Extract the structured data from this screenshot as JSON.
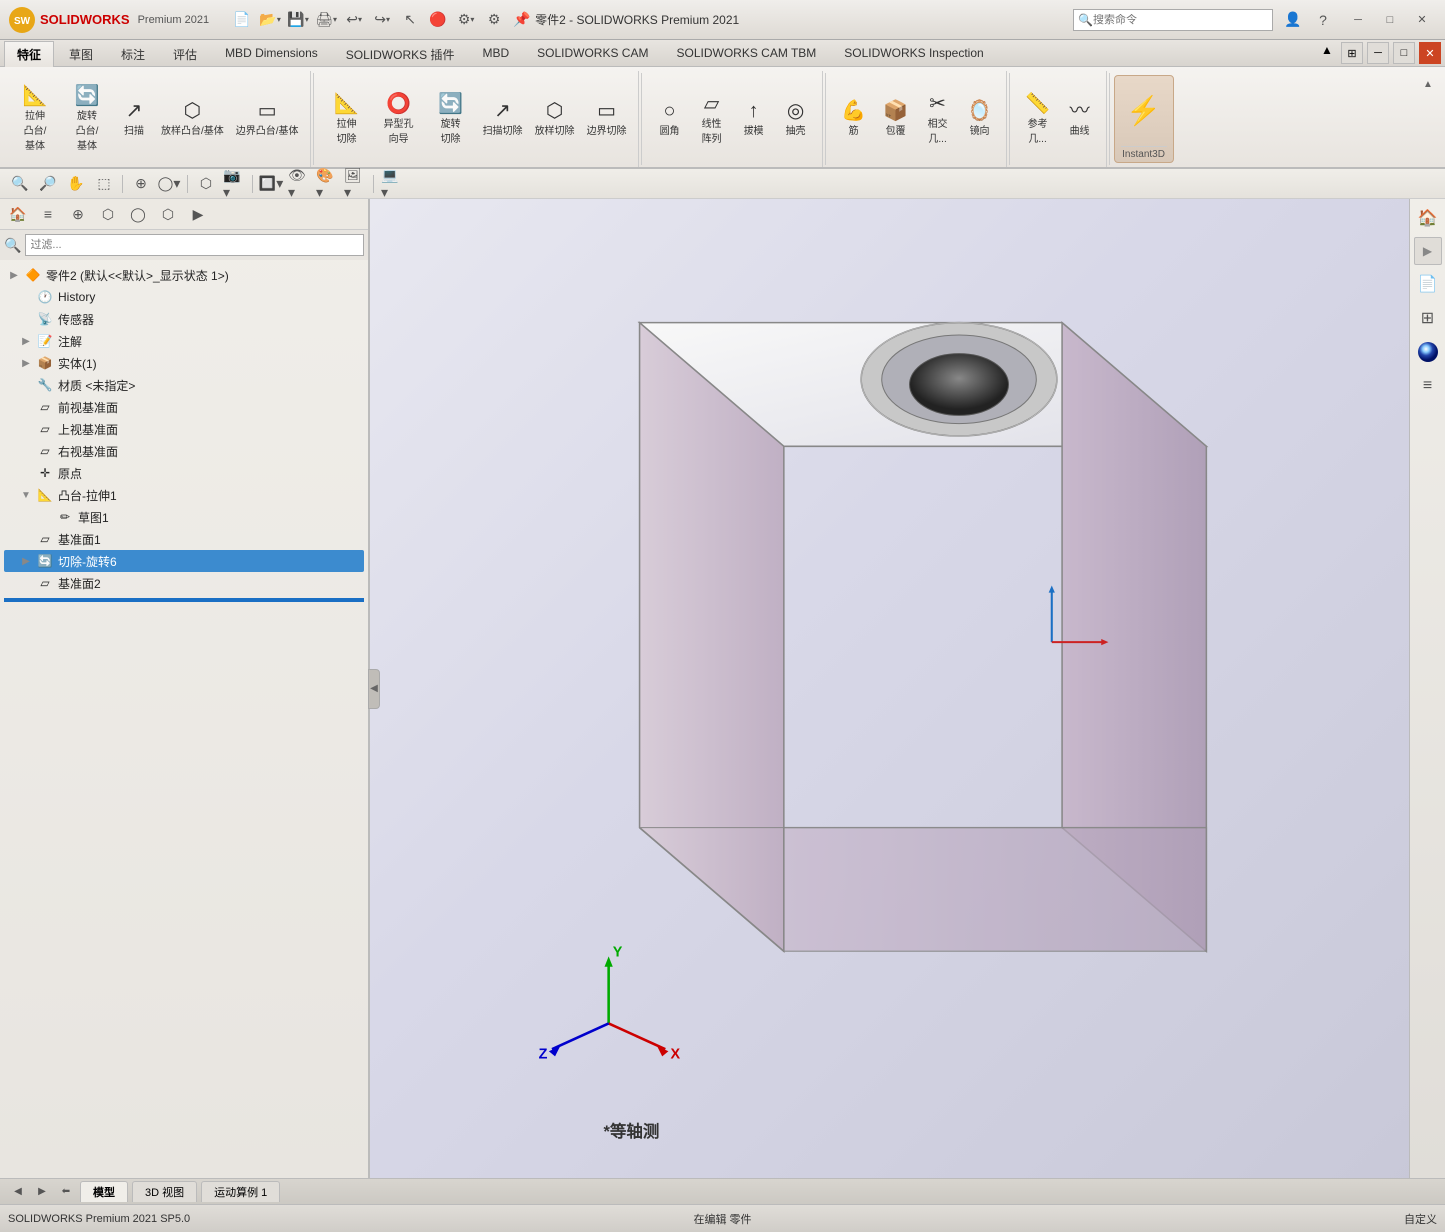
{
  "app": {
    "title": "零件2 - SOLIDWORKS Premium 2021",
    "logo_text": "SOLIDWORKS"
  },
  "titlebar": {
    "search_placeholder": "搜索命令",
    "help_icon": "?",
    "minimize": "─",
    "maximize": "□",
    "close": "✕"
  },
  "ribbon": {
    "tabs": [
      "特征",
      "草图",
      "标注",
      "评估",
      "MBD Dimensions",
      "SOLIDWORKS 插件",
      "MBD",
      "SOLIDWORKS CAM",
      "SOLIDWORKS CAM TBM",
      "SOLIDWORKS Inspection"
    ],
    "active_tab": "特征",
    "groups": [
      {
        "label": "",
        "buttons": [
          {
            "icon": "📐",
            "label": "拉伸\n凸台/\n基体"
          },
          {
            "icon": "🔄",
            "label": "旋转\n凸台/\n基体"
          },
          {
            "icon": "↗",
            "label": "扫描"
          },
          {
            "icon": "⬡",
            "label": "放样凸台/基体"
          },
          {
            "icon": "▭",
            "label": "边界凸台/基体"
          }
        ]
      },
      {
        "label": "",
        "buttons": [
          {
            "icon": "📐",
            "label": "拉伸\n切除"
          },
          {
            "icon": "⭕",
            "label": "异型孔\n向导"
          },
          {
            "icon": "🔄",
            "label": "旋转\n切除"
          },
          {
            "icon": "↗",
            "label": "扫描切除"
          },
          {
            "icon": "⬡",
            "label": "放样切除"
          },
          {
            "icon": "▭",
            "label": "边界切除"
          }
        ]
      },
      {
        "label": "",
        "buttons": [
          {
            "icon": "○",
            "label": "圆角"
          },
          {
            "icon": "▱",
            "label": "线性\n阵列"
          },
          {
            "icon": "↑",
            "label": "拔模"
          },
          {
            "icon": "◎",
            "label": "抽壳"
          }
        ]
      },
      {
        "label": "",
        "buttons": [
          {
            "icon": "💪",
            "label": "筋"
          },
          {
            "icon": "📦",
            "label": "包覆"
          },
          {
            "icon": "✂",
            "label": "相交\n几..."
          },
          {
            "icon": "🪞",
            "label": "镜向"
          }
        ]
      },
      {
        "label": "",
        "buttons": [
          {
            "icon": "📏",
            "label": "参考\n几..."
          },
          {
            "icon": "〰",
            "label": "曲线"
          }
        ]
      },
      {
        "label": "Instant3D",
        "buttons": []
      }
    ]
  },
  "view_toolbar": {
    "buttons": [
      "🔍",
      "🔎",
      "✋",
      "⬚",
      "⊕",
      "◯",
      "⬡",
      "📷",
      "🔲",
      "👁",
      "🎨",
      "🖼",
      "💻"
    ]
  },
  "feature_tree": {
    "title": "零件2 (默认<<默认>_显示状态 1>)",
    "items": [
      {
        "id": "history",
        "label": "History",
        "icon": "🕐",
        "indent": 0,
        "expandable": false
      },
      {
        "id": "sensor",
        "label": "传感器",
        "icon": "📡",
        "indent": 0,
        "expandable": false
      },
      {
        "id": "annotation",
        "label": "注解",
        "icon": "📝",
        "indent": 0,
        "expandable": true
      },
      {
        "id": "solid",
        "label": "实体(1)",
        "icon": "📦",
        "indent": 0,
        "expandable": true
      },
      {
        "id": "material",
        "label": "材质 <未指定>",
        "icon": "🔧",
        "indent": 0,
        "expandable": false
      },
      {
        "id": "front-plane",
        "label": "前视基准面",
        "icon": "▱",
        "indent": 0,
        "expandable": false
      },
      {
        "id": "top-plane",
        "label": "上视基准面",
        "icon": "▱",
        "indent": 0,
        "expandable": false
      },
      {
        "id": "right-plane",
        "label": "右视基准面",
        "icon": "▱",
        "indent": 0,
        "expandable": false
      },
      {
        "id": "origin",
        "label": "原点",
        "icon": "✛",
        "indent": 0,
        "expandable": false
      },
      {
        "id": "boss-extrude1",
        "label": "凸台-拉伸1",
        "icon": "📐",
        "indent": 0,
        "expandable": true,
        "expanded": true,
        "selected": false
      },
      {
        "id": "sketch1",
        "label": "草图1",
        "icon": "✏",
        "indent": 1,
        "expandable": false
      },
      {
        "id": "plane1",
        "label": "基准面1",
        "icon": "▱",
        "indent": 0,
        "expandable": false
      },
      {
        "id": "cut-revolve6",
        "label": "切除-旋转6",
        "icon": "🔄",
        "indent": 0,
        "expandable": true,
        "selected": true
      },
      {
        "id": "plane2",
        "label": "基准面2",
        "icon": "▱",
        "indent": 0,
        "expandable": false
      }
    ]
  },
  "bottom_tabs": {
    "tabs": [
      "模型",
      "3D 视图",
      "运动算例 1"
    ],
    "active": "模型"
  },
  "statusbar": {
    "left": "SOLIDWORKS Premium 2021 SP5.0",
    "mid": "在编辑 零件",
    "right": "自定义"
  },
  "viewport": {
    "view_label": "*等轴测",
    "axis_x": "X",
    "axis_y": "Y",
    "axis_z": "Z"
  },
  "right_sidebar": {
    "buttons": [
      "🏠",
      "▶",
      "📄",
      "📐",
      "🎨",
      "📋"
    ]
  },
  "panel": {
    "collapse_arrow": "◀"
  }
}
